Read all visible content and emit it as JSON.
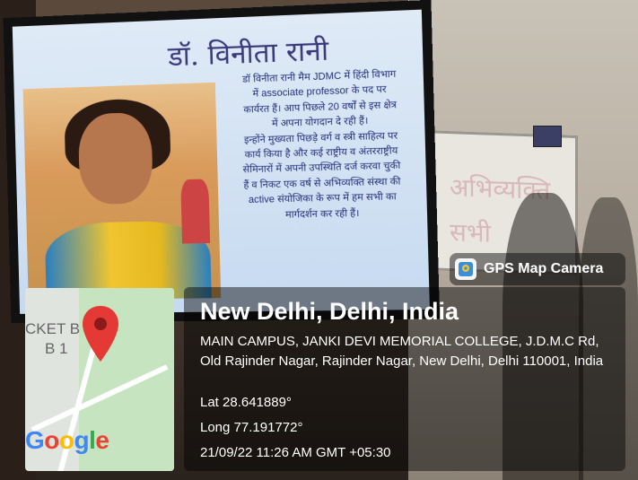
{
  "slide": {
    "title": "डॉ. विनीता रानी",
    "body_lines": [
      "डॉ विनीता रानी मैम JDMC में हिंदी विभाग",
      "में associate professor के पद पर",
      "कार्यरत हैं। आप पिछले 20 वर्षों से इस क्षेत्र",
      "में अपना योगदान दे रही हैं।",
      "इन्होंने मुख्यता पिछड़े वर्ग व स्त्री साहित्य पर",
      "कार्य किया है और कई राष्ट्रीय व अंतरराष्ट्रीय",
      "सेमिनारों में अपनी उपस्थिति दर्ज करवा चुकी",
      "हैं व निकट एक वर्ष से अभिव्यक्ति संस्था की",
      "active संयोजिका के रूप में हम सभी का",
      "मार्गदर्शन कर रही हैं।"
    ]
  },
  "whiteboard": {
    "line1": "अभिव्यक्ति",
    "line2": "सभी"
  },
  "gps": {
    "app_label": "GPS Map Camera",
    "app_icon": "gps-map-camera-icon",
    "city": "New Delhi, Delhi, India",
    "address": "MAIN CAMPUS, JANKI DEVI MEMORIAL COLLEGE, J.D.M.C Rd, Old Rajinder Nagar, Rajinder Nagar, New Delhi, Delhi 110001, India",
    "lat": "Lat 28.641889°",
    "long": "Long 77.191772°",
    "datetime": "21/09/22 11:26 AM GMT +05:30"
  },
  "map": {
    "label1": "CKET B",
    "label2": "B 1",
    "logo": "Google",
    "pin_color": "#e53935"
  }
}
